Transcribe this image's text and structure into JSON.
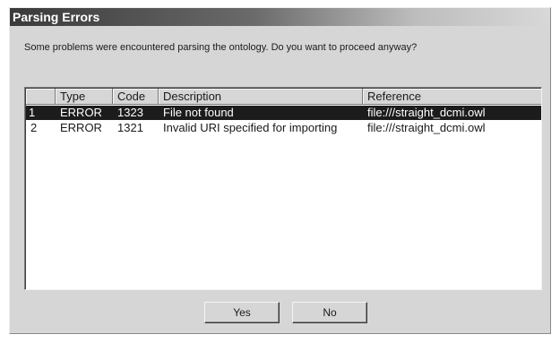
{
  "dialog": {
    "title": "Parsing Errors",
    "message": "Some problems were encountered parsing the ontology. Do you want to proceed anyway?"
  },
  "table": {
    "columns": [
      "",
      "Type",
      "Code",
      "Description",
      "Reference"
    ],
    "rows": [
      [
        "1",
        "ERROR",
        "1323",
        "File not found",
        "file:///straight_dcmi.owl"
      ],
      [
        "2",
        "ERROR",
        "1321",
        "Invalid URI specified for importing",
        "file:///straight_dcmi.owl"
      ]
    ],
    "selected_row": 1
  },
  "buttons": {
    "yes_label": "Yes",
    "no_label": "No"
  }
}
